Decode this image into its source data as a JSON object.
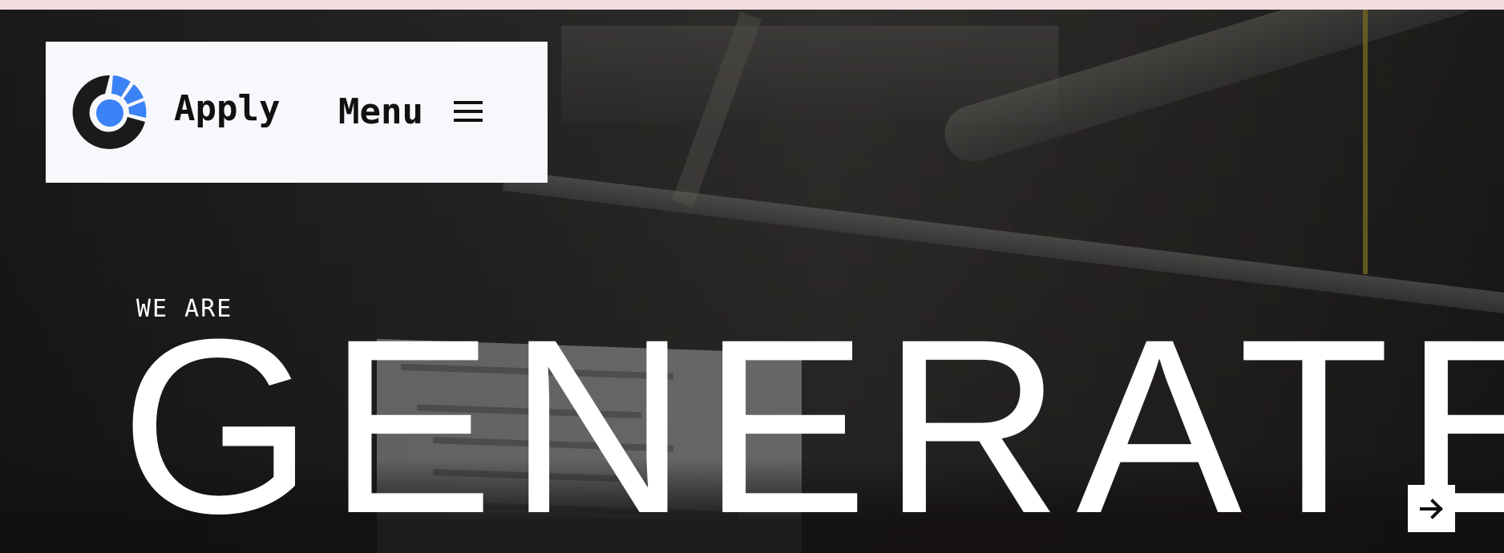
{
  "header": {
    "logo_icon": "generate-logo-icon",
    "apply_label": "Apply",
    "menu_label": "Menu",
    "menu_icon": "hamburger-icon"
  },
  "hero": {
    "eyebrow": "WE ARE",
    "headline": "GENERATE",
    "next_icon": "arrow-right-icon"
  },
  "colors": {
    "top_strip": "#f3dde1",
    "header_bg": "#f7f8fb",
    "logo_blue": "#3b82f6",
    "logo_dark": "#1a1a1a",
    "text_dark": "#111111",
    "text_light": "#ffffff"
  }
}
